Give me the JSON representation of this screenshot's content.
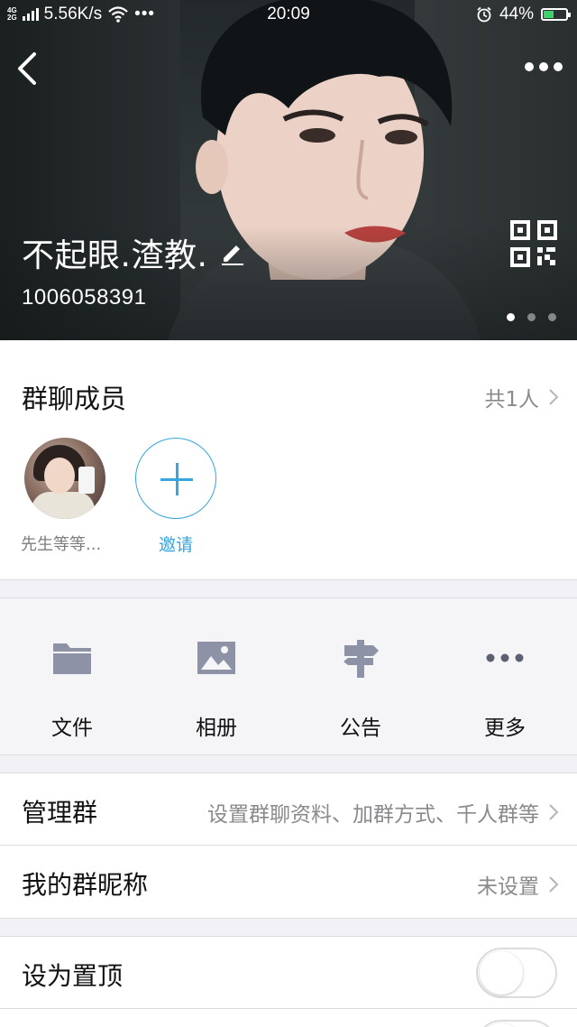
{
  "status_bar": {
    "network_top": "4G",
    "network_bottom": "2G",
    "speed": "5.56K/s",
    "time": "20:09",
    "battery": "44%",
    "battery_level": 0.44,
    "icons": [
      "signal-icon",
      "wifi-icon",
      "more-notifications-icon",
      "alarm-icon",
      "battery-charging-icon"
    ]
  },
  "header": {
    "group_name": "不起眼.渣教.",
    "group_id": "1006058391",
    "carousel_pages": 3,
    "carousel_active": 1,
    "icons": [
      "back-icon",
      "more-icon",
      "edit-pencil-icon",
      "qr-code-icon"
    ]
  },
  "members": {
    "title": "群聊成员",
    "count_label": "共1人",
    "list": [
      {
        "name": "先生等等..."
      }
    ],
    "invite_label": "邀请"
  },
  "functions": [
    {
      "label": "文件",
      "icon": "folder-icon"
    },
    {
      "label": "相册",
      "icon": "image-icon"
    },
    {
      "label": "公告",
      "icon": "signpost-icon"
    },
    {
      "label": "更多",
      "icon": "more-dots-icon"
    }
  ],
  "settings": {
    "manage": {
      "title": "管理群",
      "value": "设置群聊资料、加群方式、千人群等"
    },
    "nickname": {
      "title": "我的群昵称",
      "value": "未设置"
    },
    "pin": {
      "title": "设为置顶",
      "on": false
    }
  },
  "colors": {
    "accent": "#35a6de",
    "secondary_text": "#8a8a8e",
    "icon_gray": "#8e92a6"
  }
}
